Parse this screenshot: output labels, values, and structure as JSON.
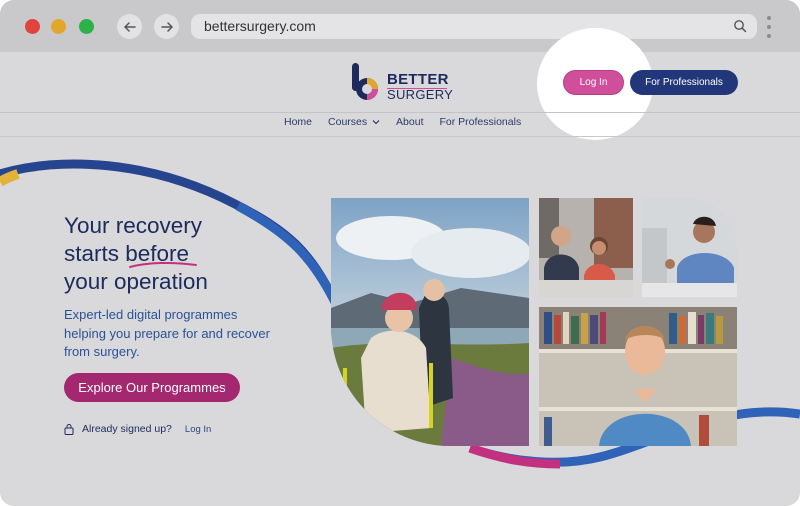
{
  "browser": {
    "url": "bettersurgery.com",
    "back_icon": "arrow-left-icon",
    "forward_icon": "arrow-right-icon",
    "search_icon": "search-icon",
    "traffic_lights": [
      "#e0443e",
      "#e0a72b",
      "#2fb14a"
    ]
  },
  "header": {
    "logo": {
      "line1": "BETTER",
      "line2": "SURGERY"
    },
    "login_label": "Log In",
    "professionals_label": "For Professionals"
  },
  "nav": {
    "items": [
      {
        "label": "Home"
      },
      {
        "label": "Courses"
      },
      {
        "label": "About"
      },
      {
        "label": "For Professionals"
      }
    ]
  },
  "hero": {
    "title_line1": "Your recovery",
    "title_line2a": "starts ",
    "title_line2b": "before",
    "title_line3": "your operation",
    "subtitle": "Expert-led digital programmes helping you prepare for and recover from surgery.",
    "cta_label": "Explore Our Programmes",
    "signed_up_text": "Already signed up?",
    "signed_up_link": "Log In"
  },
  "colors": {
    "brand_navy": "#1d2b5c",
    "brand_blue": "#21377a",
    "brand_pink": "#d04f9b",
    "cta_magenta": "#a3286f",
    "wave_blue": "#2e63b8"
  }
}
